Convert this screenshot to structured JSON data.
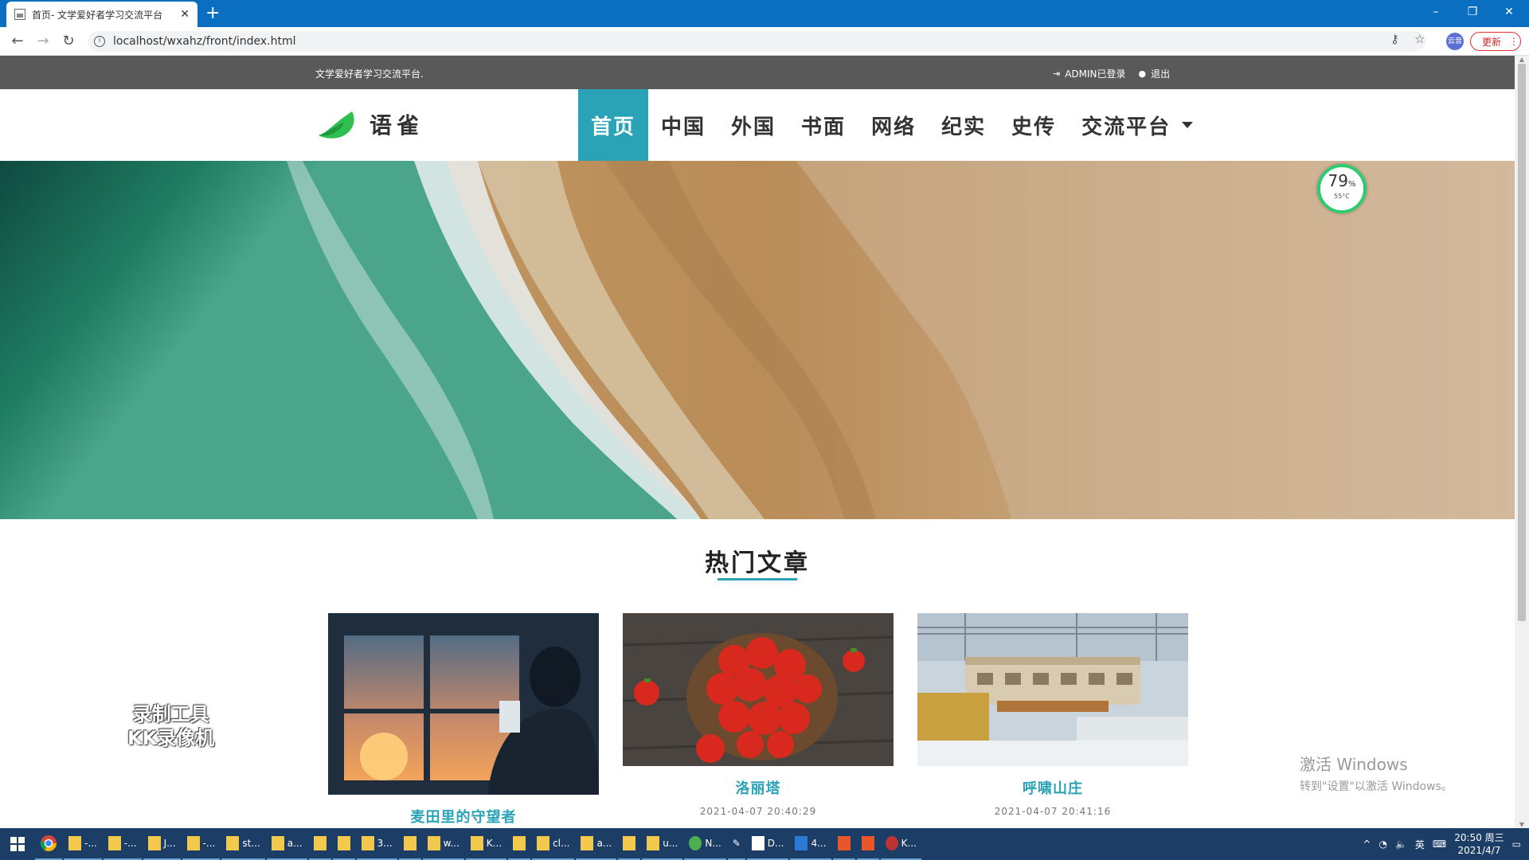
{
  "browser": {
    "tab_title": "首页- 文学爱好者学习交流平台",
    "url": "localhost/wxahz/front/index.html",
    "update_label": "更新",
    "profile_label": "云音"
  },
  "site": {
    "slogan": "文学爱好者学习交流平台.",
    "login_status": "ADMIN已登录",
    "logout_label": "退出",
    "logo_name": "语雀",
    "nav": [
      "首页",
      "中国",
      "外国",
      "书面",
      "网络",
      "纪实",
      "史传",
      "交流平台"
    ],
    "active_nav": "首页",
    "accent_color": "#2aa3b7"
  },
  "gauge": {
    "percent": "79",
    "unit": "%",
    "temp": "55°C"
  },
  "section": {
    "title": "热门文章"
  },
  "articles": [
    {
      "title": "麦田里的守望者",
      "date": "",
      "image": "person-at-window-sunset"
    },
    {
      "title": "洛丽塔",
      "date": "2021-04-07 20:40:29",
      "image": "strawberries-bowl"
    },
    {
      "title": "呼啸山庄",
      "date": "2021-04-07 20:41:16",
      "image": "snowy-train-station"
    }
  ],
  "overlay": {
    "recorder_line1": "录制工具",
    "recorder_line2": "KK录像机",
    "activate_line1": "激活 Windows",
    "activate_line2": "转到\"设置\"以激活 Windows。"
  },
  "taskbar": {
    "items": [
      "-...",
      "-...",
      "J...",
      "-...",
      "st...",
      "a...",
      "",
      "",
      "3...",
      "",
      "w...",
      "K...",
      "",
      "cl...",
      "a...",
      "",
      "u...",
      "N...",
      "",
      "D...",
      "4...",
      "",
      "",
      "K..."
    ],
    "ime": "英",
    "time": "20:50 周三",
    "date": "2021/4/7"
  }
}
